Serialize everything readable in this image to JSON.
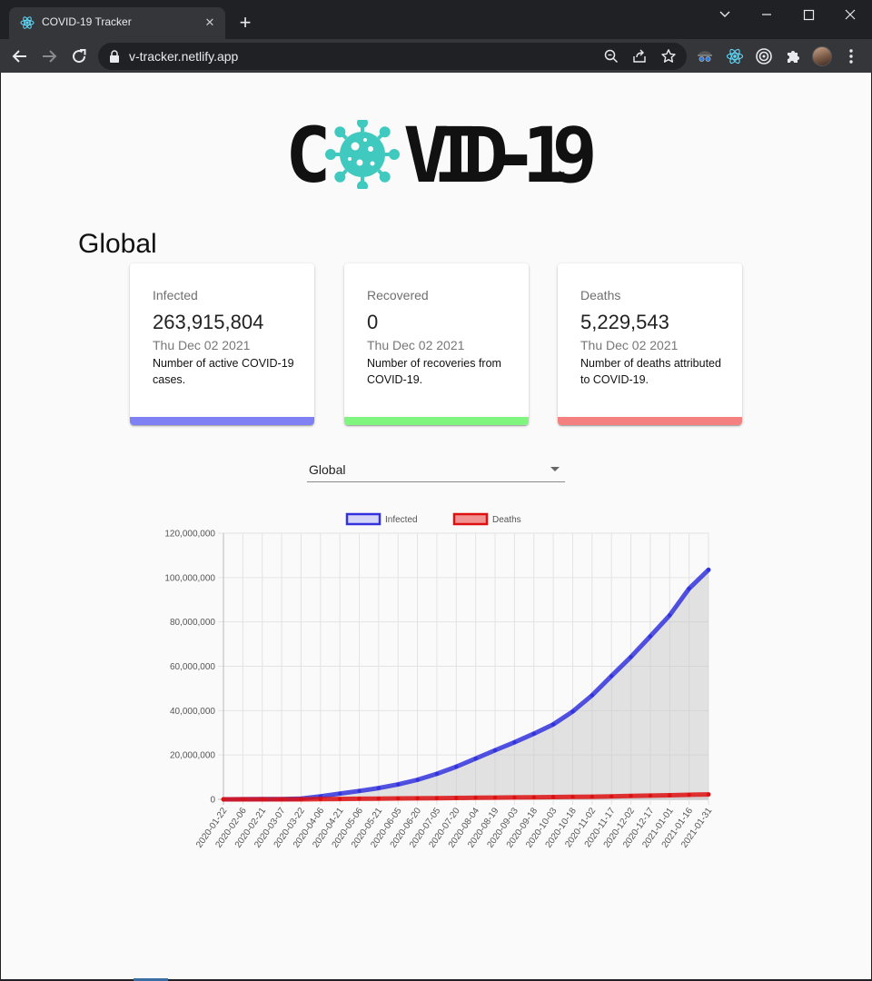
{
  "browser": {
    "tab_title": "COVID-19 Tracker",
    "tab_close": "✕",
    "new_tab": "+",
    "url": "v-tracker.netlify.app"
  },
  "logo": {
    "text": "C VID-19"
  },
  "section": {
    "title": "Global"
  },
  "cards": [
    {
      "label": "Infected",
      "value": "263,915,804",
      "date": "Thu Dec 02 2021",
      "description": "Number of active COVID-19 cases.",
      "color": "#8080f5"
    },
    {
      "label": "Recovered",
      "value": "0",
      "date": "Thu Dec 02 2021",
      "description": "Number of recoveries from COVID-19.",
      "color": "#80f580"
    },
    {
      "label": "Deaths",
      "value": "5,229,543",
      "date": "Thu Dec 02 2021",
      "description": "Number of deaths attributed to COVID-19.",
      "color": "#f58080"
    }
  ],
  "country_select": {
    "value": "Global"
  },
  "chart_data": {
    "type": "line",
    "title": "",
    "xlabel": "",
    "ylabel": "",
    "ylim": [
      0,
      120000000
    ],
    "yticks": [
      "120,000,000",
      "100,000,000",
      "80,000,000",
      "60,000,000",
      "40,000,000",
      "20,000,000",
      "0"
    ],
    "legend": "top",
    "grid": true,
    "x": [
      "2020-01-22",
      "2020-02-06",
      "2020-02-21",
      "2020-03-07",
      "2020-03-22",
      "2020-04-06",
      "2020-04-21",
      "2020-05-06",
      "2020-05-21",
      "2020-06-05",
      "2020-06-20",
      "2020-07-05",
      "2020-07-20",
      "2020-08-04",
      "2020-08-19",
      "2020-09-03",
      "2020-09-18",
      "2020-10-03",
      "2020-10-18",
      "2020-11-02",
      "2020-11-17",
      "2020-12-02",
      "2020-12-17",
      "2021-01-01",
      "2021-01-16",
      "2021-01-31"
    ],
    "series": [
      {
        "name": "Infected",
        "color": "#3333dd",
        "fill": "rgba(200,200,200,0.5)",
        "values": [
          500,
          28000,
          76000,
          106000,
          340000,
          1350000,
          2560000,
          3760000,
          5080000,
          6700000,
          8800000,
          11500000,
          14700000,
          18400000,
          22100000,
          25700000,
          29600000,
          33800000,
          39600000,
          46900000,
          55600000,
          64200000,
          73500000,
          83000000,
          95000000,
          103500000
        ]
      },
      {
        "name": "Deaths",
        "color": "#dd1111",
        "fill": "rgba(200,200,200,0.5)",
        "values": [
          17,
          565,
          2250,
          3600,
          14700,
          74000,
          177000,
          262000,
          330000,
          395000,
          465000,
          535000,
          612000,
          700000,
          790000,
          870000,
          950000,
          1030000,
          1110000,
          1200000,
          1310000,
          1500000,
          1660000,
          1840000,
          2030000,
          2210000
        ]
      }
    ]
  }
}
